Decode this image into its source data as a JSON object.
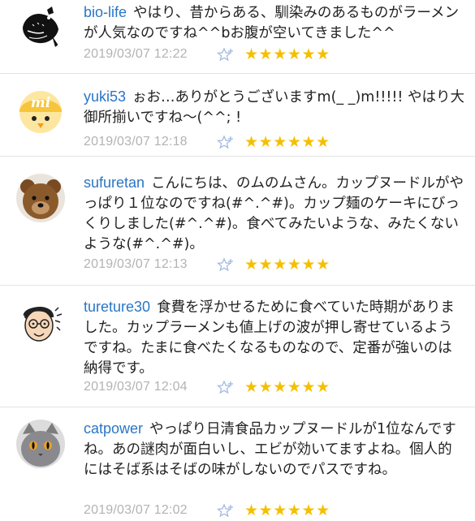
{
  "comments": [
    {
      "username": "bio-life",
      "text": "やはり、昔からある、馴染みのあるものがラーメンが人気なのですね^^bお腹が空いてきました^^",
      "timestamp": "2019/03/07 12:22",
      "stars": "★★★★★★",
      "avatar_icon": "bird-silhouette-avatar"
    },
    {
      "username": "yuki53",
      "text": "ぉお…ありがとうございますm(_ _)m!!!!! やはり大御所揃いですね〜(^^; !",
      "timestamp": "2019/03/07 12:18",
      "stars": "★★★★★★",
      "avatar_icon": "yellow-chick-avatar"
    },
    {
      "username": "sufuretan",
      "text": "こんにちは、のムのムさん。カップヌードルがやっぱり１位なのですね(#^.^#)。カップ麺のケーキにびっくりしました(#^.^#)。食べてみたいような、みたくないような(#^.^#)。",
      "timestamp": "2019/03/07 12:13",
      "stars": "★★★★★★",
      "avatar_icon": "teddy-bear-avatar"
    },
    {
      "username": "tureture30",
      "text": "食費を浮かせるために食べていた時期がありました。カップラーメンも値上げの波が押し寄せているようですね。たまに食べたくなるものなので、定番が強いのは納得です。",
      "timestamp": "2019/03/07 12:04",
      "stars": "★★★★★★",
      "avatar_icon": "cartoon-man-glasses-avatar"
    },
    {
      "username": "catpower",
      "text": "やっぱり日清食品カップヌードルが1位なんですね。あの謎肉が面白いし、エビが効いてますよね。個人的にはそば系はそばの味がしないのでパスですね。",
      "timestamp": "2019/03/07 12:02",
      "stars": "★★★★★★",
      "avatar_icon": "gray-cat-avatar"
    }
  ],
  "colors": {
    "username": "#2a76c6",
    "timestamp": "#b3b3b3",
    "star": "#f5bf00",
    "fav_icon": "#9db6e0"
  }
}
